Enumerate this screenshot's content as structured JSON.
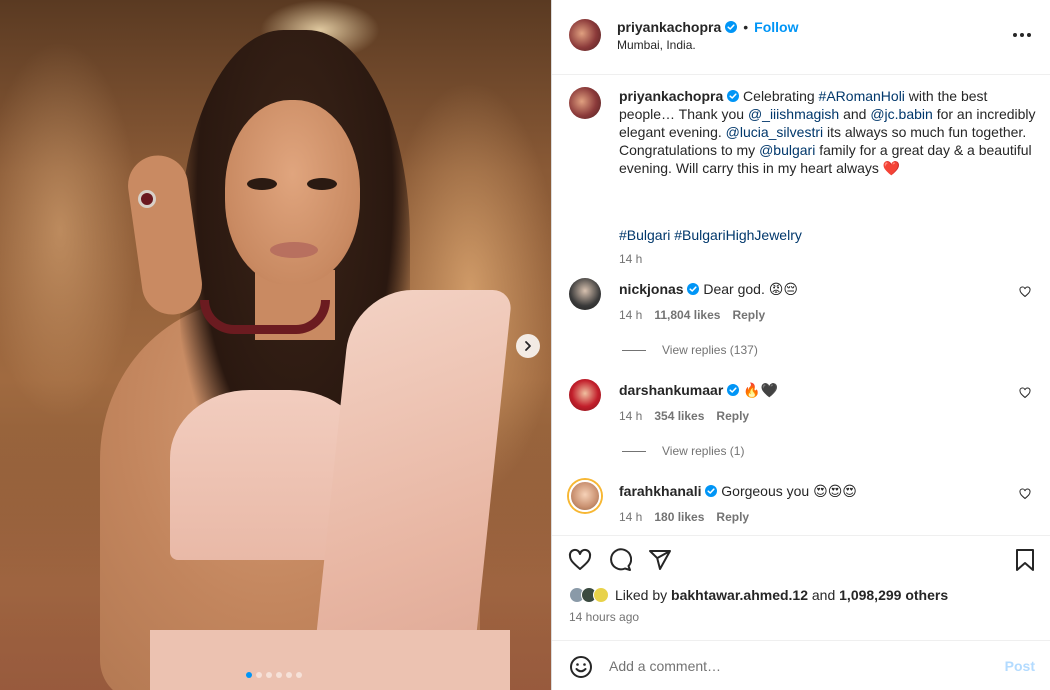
{
  "post": {
    "author": "priyankachopra",
    "location": "Mumbai, India.",
    "follow_label": "Follow",
    "separator": "•",
    "media_count": 6,
    "active_index": 0
  },
  "caption": {
    "author": "priyankachopra",
    "text_1": "Celebrating ",
    "tag_1": "#ARomanHoli",
    "text_2": " with the best people… Thank you ",
    "tag_2": "@_iiishmagish",
    "text_3": " and ",
    "tag_3": "@jc.babin",
    "text_4": " for an incredibly elegant evening. ",
    "tag_4": "@lucia_silvestri",
    "text_5": " its always so much fun together. Congratulations to my ",
    "tag_5": "@bulgari",
    "text_6": " family for a great day & a beautiful evening. Will carry this in my heart always ",
    "emoji": "❤️",
    "hashtags": "#Bulgari #BulgariHighJewelry",
    "time": "14 h"
  },
  "comments": [
    {
      "user": "nickjonas",
      "text": "Dear god. 😡😔",
      "time": "14 h",
      "likes": "11,804 likes",
      "reply_label": "Reply",
      "view_replies": "View replies (137)"
    },
    {
      "user": "darshankumaar",
      "text": "🔥🖤",
      "time": "14 h",
      "likes": "354 likes",
      "reply_label": "Reply",
      "view_replies": "View replies (1)"
    },
    {
      "user": "farahkhanali",
      "text": "Gorgeous you 😍😍😍",
      "time": "14 h",
      "likes": "180 likes",
      "reply_label": "Reply"
    }
  ],
  "actions": {
    "icons": [
      "heart-icon",
      "comment-icon",
      "share-icon",
      "bookmark-icon"
    ]
  },
  "likes": {
    "prefix": "Liked by ",
    "user": "bakhtawar.ahmed.12",
    "middle": " and ",
    "others": "1,098,299 others"
  },
  "post_time": "14 hours ago",
  "comment_input": {
    "placeholder": "Add a comment…",
    "post_label": "Post"
  },
  "colors": {
    "accent": "#0095f6",
    "link": "#00376b",
    "muted": "#737373",
    "post_disabled": "#b3dbff",
    "like_red": "#ed4956"
  }
}
